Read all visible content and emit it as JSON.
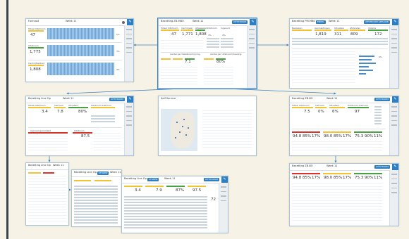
{
  "colors": {
    "background": "#f6f2e6",
    "accent": "#2d7fc1",
    "warning": "#f1c232",
    "bad": "#d9342b",
    "good": "#48a23f",
    "edge": "#3a82c4"
  },
  "frames": {
    "forecast": {
      "title": "Forecast",
      "week": "Week 11",
      "subtitles": [
        "Totaal Uitstroom",
        "Uitstroom",
        "Inschrijfaanbod"
      ],
      "values": [
        "47",
        "1,775",
        "1,808"
      ],
      "pct": [
        "5%",
        "3%",
        "4%"
      ],
      "side": [
        "%"
      ]
    },
    "zb_mbo": {
      "title": "Bezetting ZB-MBO",
      "week": "Week 11",
      "badge": "UITSTROOM",
      "subtitles": [
        "Totaal Uitstroom",
        "Inschrijven",
        "Afgewezen",
        "Uitstroom",
        "Ingevuld"
      ],
      "values": [
        "47",
        "1,771",
        "1,808"
      ],
      "pct": [
        "3%",
        "4%"
      ],
      "panel_titles": [
        "Aantal per Detailinschrijving",
        "Aantal per Uitstroom/heading"
      ],
      "row_values": [
        "7.1",
        "80%"
      ]
    },
    "pm_mbo": {
      "title": "Bezetting PM-MBO",
      "badge1": "ENKEL",
      "week": "Week 11",
      "badge2": "UITSTROOM GEPLAND",
      "subtitles": [
        "Bezoeken",
        "Aanmeldingen",
        "Uitvallers",
        "Afstanden",
        "Volume"
      ],
      "values": [
        "1,819",
        "311",
        "809",
        "172"
      ],
      "extra_values": [
        "4%"
      ]
    },
    "live_op": {
      "title": "Bezetting Live Op",
      "week": "Week 11",
      "badge": "UITSTROOM",
      "subtitles": [
        "Totaal Uitstroom",
        "Instroom",
        "Uitvallers",
        "Uitstroom-Instroom"
      ],
      "values": [
        "3.4",
        "7.8",
        "80%",
        "87.5"
      ],
      "panel_titles": [
        "Instroomgemiddeld",
        "Uitstroom"
      ]
    },
    "self_service": {
      "title": "Self Service"
    },
    "zb_bo": {
      "title": "Bezetting ZB-BO",
      "week": "Week 11",
      "badge": "UITSTROOM",
      "subtitles": [
        "Totaal Uitstroom",
        "Instroom",
        "Uitvallers",
        "Uitstroom-Instroom"
      ],
      "values": [
        "7.5",
        "0%",
        "6%",
        "97"
      ],
      "row_values": [
        "94.8",
        "85%",
        "17%",
        "98.0",
        "85%",
        "17%",
        "75.3",
        "90%",
        "11%"
      ]
    },
    "live_op_small": {
      "title": "Bezetting Live Op",
      "week": "Week 11"
    },
    "live_op_stack1": {
      "title": "Bezetting Live Op",
      "badge": "STOREN",
      "week": "Week 11"
    },
    "live_op_stack2": {
      "title": "Bezetting Live Op",
      "badge1": "STOREN",
      "week": "Week 11",
      "badge2": "UITSTROOM",
      "values": [
        "3.4",
        "7.9",
        "87%",
        "97.5",
        "72"
      ]
    },
    "bottom_right": {
      "title": "Bezetting ZB-BO",
      "week": "Week 11",
      "badge": "UITSTROOM",
      "row_values": [
        "94.8",
        "85%",
        "17%",
        "98.0",
        "85%",
        "17%",
        "75.3",
        "90%",
        "11%"
      ]
    }
  }
}
